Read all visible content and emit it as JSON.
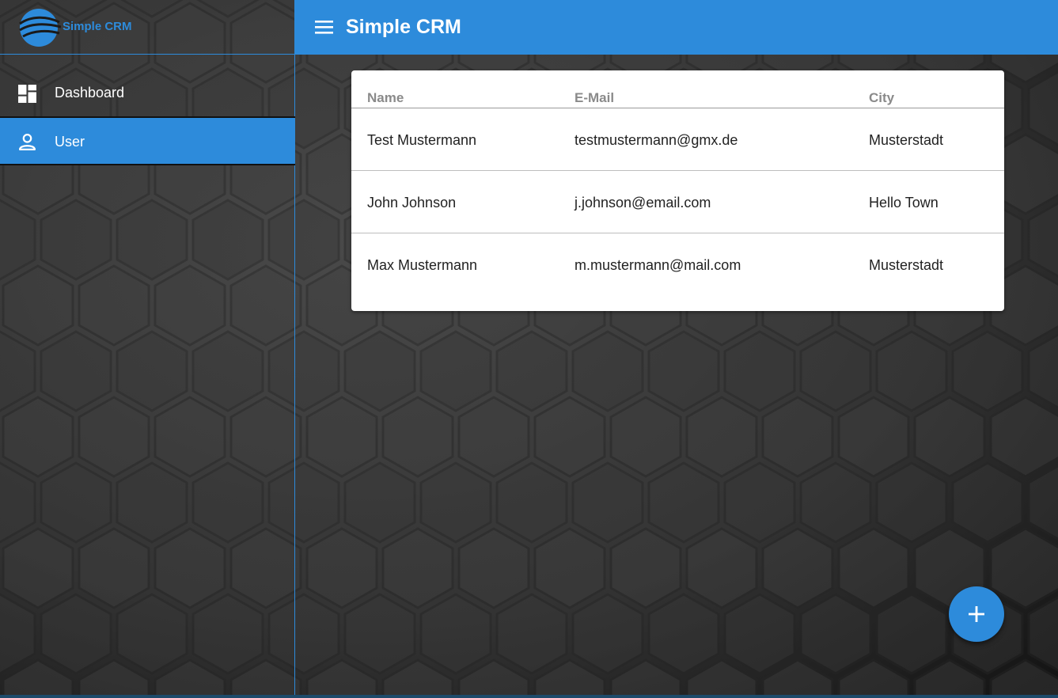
{
  "brand": {
    "logo_text": "Simple CRM",
    "accent_color": "#2d8bdb"
  },
  "sidebar": {
    "items": [
      {
        "label": "Dashboard",
        "icon": "dashboard-icon",
        "active": false
      },
      {
        "label": "User",
        "icon": "person-icon",
        "active": true
      }
    ]
  },
  "header": {
    "title": "Simple CRM",
    "menu_icon": "menu-icon"
  },
  "table": {
    "columns": [
      "Name",
      "E-Mail",
      "City"
    ],
    "rows": [
      {
        "name": "Test Mustermann",
        "email": "testmustermann@gmx.de",
        "city": "Musterstadt"
      },
      {
        "name": "John Johnson",
        "email": "j.johnson@email.com",
        "city": "Hello Town"
      },
      {
        "name": "Max Mustermann",
        "email": "m.mustermann@mail.com",
        "city": "Musterstadt"
      }
    ]
  },
  "fab": {
    "icon": "plus-icon"
  }
}
